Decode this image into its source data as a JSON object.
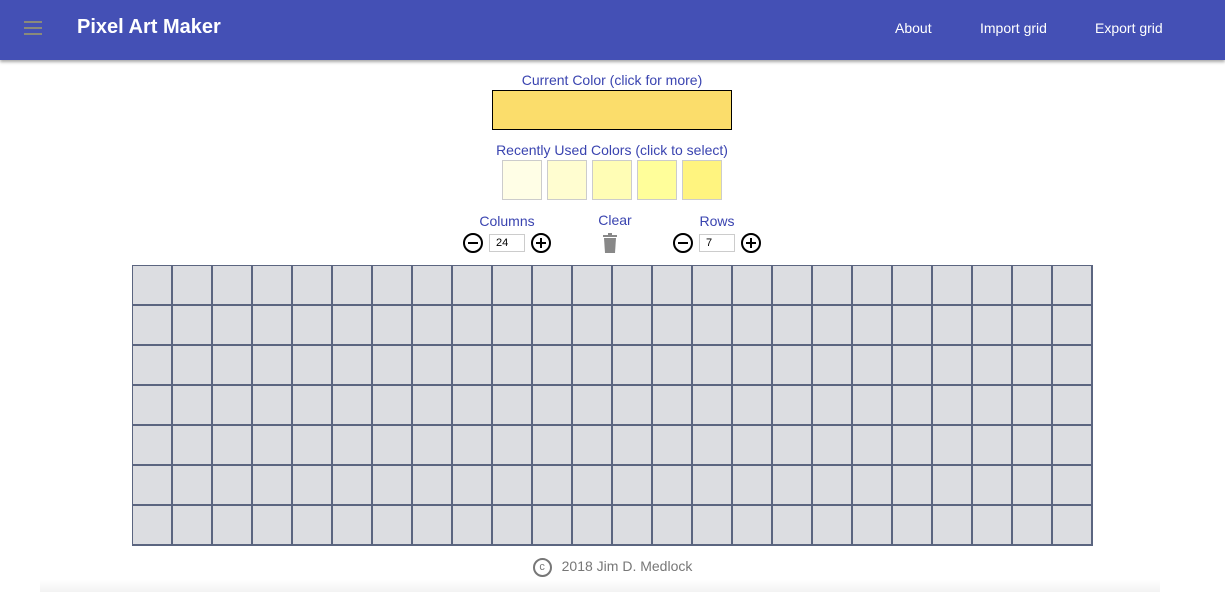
{
  "nav": {
    "title": "Pixel Art Maker",
    "links": [
      "About",
      "Import grid",
      "Export grid"
    ]
  },
  "current_color": {
    "label": "Current Color (click for more)",
    "value": "#fbdd6b"
  },
  "recent": {
    "label": "Recently Used Colors (click to select)",
    "colors": [
      "#fffee6",
      "#fffdd0",
      "#fffdb5",
      "#fffe9a",
      "#fff47f"
    ]
  },
  "columns": {
    "label": "Columns",
    "value": "24"
  },
  "clear": {
    "label": "Clear"
  },
  "rows": {
    "label": "Rows",
    "value": "7"
  },
  "grid": {
    "cols": 24,
    "rows": 7,
    "cell_color": "#dcdde1",
    "line_color": "#5b6580"
  },
  "footer": {
    "copyright_symbol": "c",
    "text": "2018 Jim D. Medlock"
  },
  "colors": {
    "nav": "#4450b5",
    "label": "#3a44b0"
  }
}
